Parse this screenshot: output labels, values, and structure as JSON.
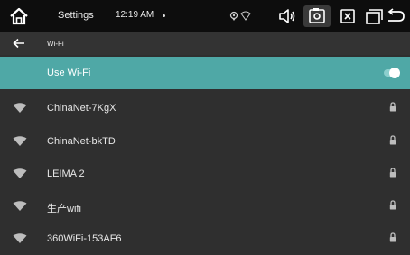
{
  "status_bar": {
    "title": "Settings",
    "time": "12:19 AM"
  },
  "app_bar": {
    "title": "Wi-Fi"
  },
  "wifi_toggle": {
    "label": "Use Wi-Fi",
    "enabled": true
  },
  "networks": [
    {
      "ssid": "ChinaNet-7KgX",
      "secured": true
    },
    {
      "ssid": "ChinaNet-bkTD",
      "secured": true
    },
    {
      "ssid": "LEIMA 2",
      "secured": true
    },
    {
      "ssid": "生产wifi",
      "secured": true
    },
    {
      "ssid": "360WiFi-153AF6",
      "secured": true
    }
  ]
}
